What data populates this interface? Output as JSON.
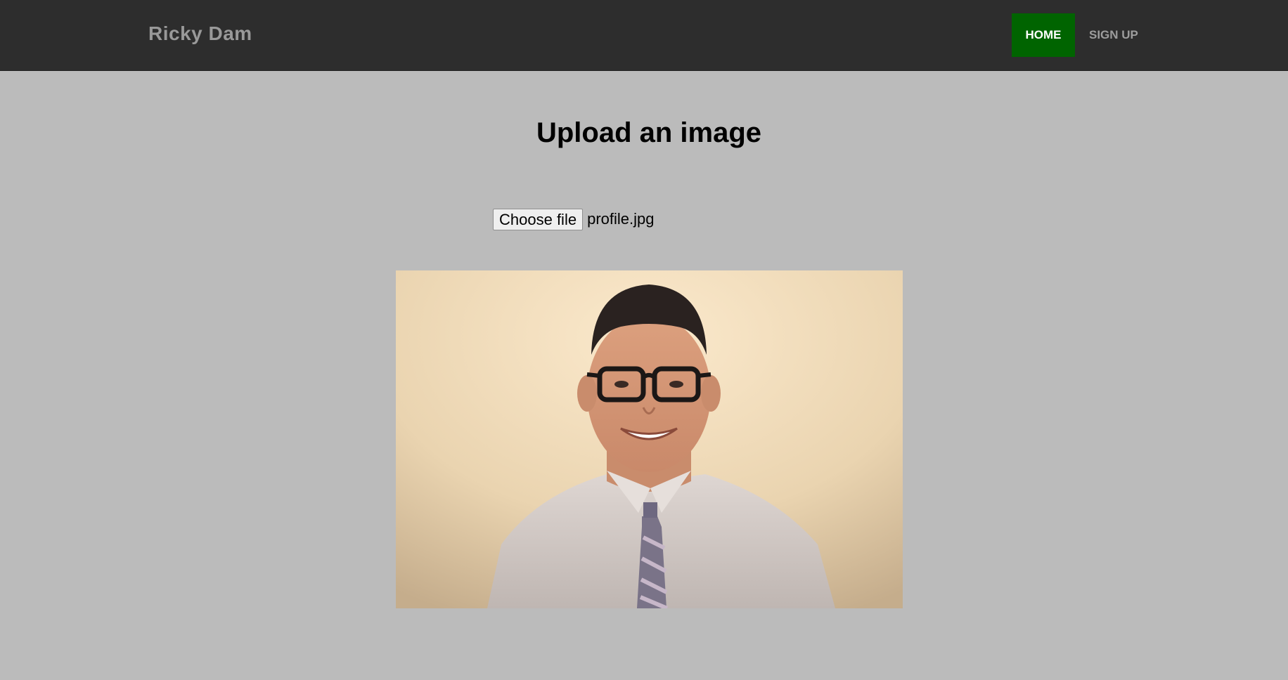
{
  "navbar": {
    "brand": "Ricky Dam",
    "items": [
      {
        "label": "HOME",
        "active": true
      },
      {
        "label": "SIGN UP",
        "active": false
      }
    ],
    "colors": {
      "background": "#2d2d2d",
      "active": "#006400"
    }
  },
  "main": {
    "title": "Upload an image",
    "file_input": {
      "button_label": "Choose file",
      "selected_file": "profile.jpg"
    },
    "preview": {
      "icon": "profile-photo"
    }
  }
}
